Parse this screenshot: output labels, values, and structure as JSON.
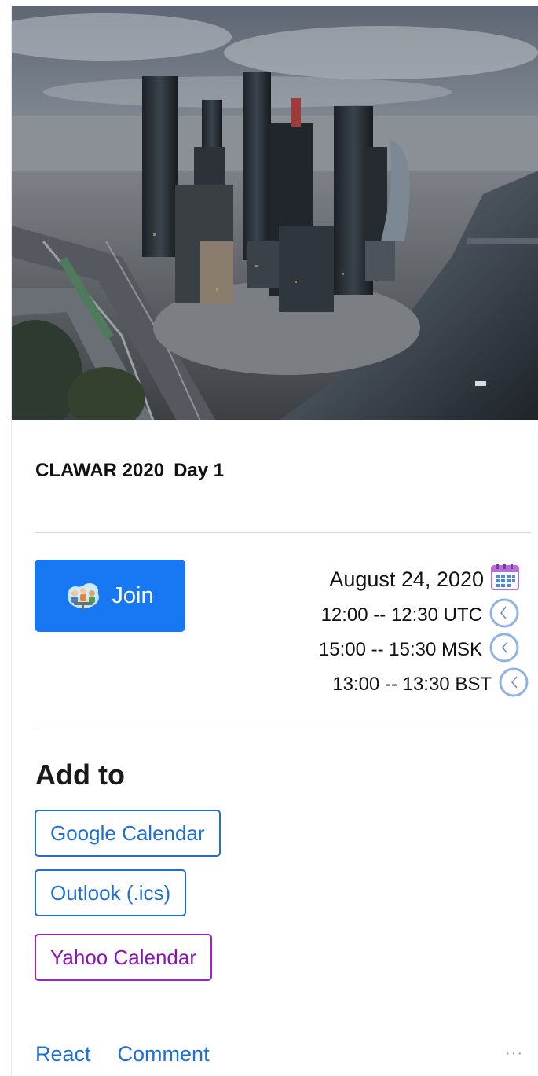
{
  "event": {
    "title": "CLAWAR 2020",
    "day": "Day 1",
    "join_label": "Join",
    "date": "August 24, 2020",
    "times": [
      {
        "label": "12:00 -- 12:30 UTC"
      },
      {
        "label": "15:00 -- 15:30 MSK"
      },
      {
        "label": "13:00 -- 13:30 BST"
      }
    ]
  },
  "add_to": {
    "heading": "Add to",
    "buttons": [
      {
        "label": "Google Calendar"
      },
      {
        "label": "Outlook (.ics)"
      },
      {
        "label": "Yahoo Calendar"
      }
    ]
  },
  "footer": {
    "react_label": "React",
    "comment_label": "Comment",
    "more_label": "···"
  },
  "icons": {
    "join": "meeting-people-icon",
    "calendar": "calendar-icon",
    "clock": "clock-icon"
  },
  "colors": {
    "primary": "#1877f2",
    "link": "#1d6fd6",
    "yahoo": "#8a14b8",
    "clock": "#8fb3e6"
  }
}
